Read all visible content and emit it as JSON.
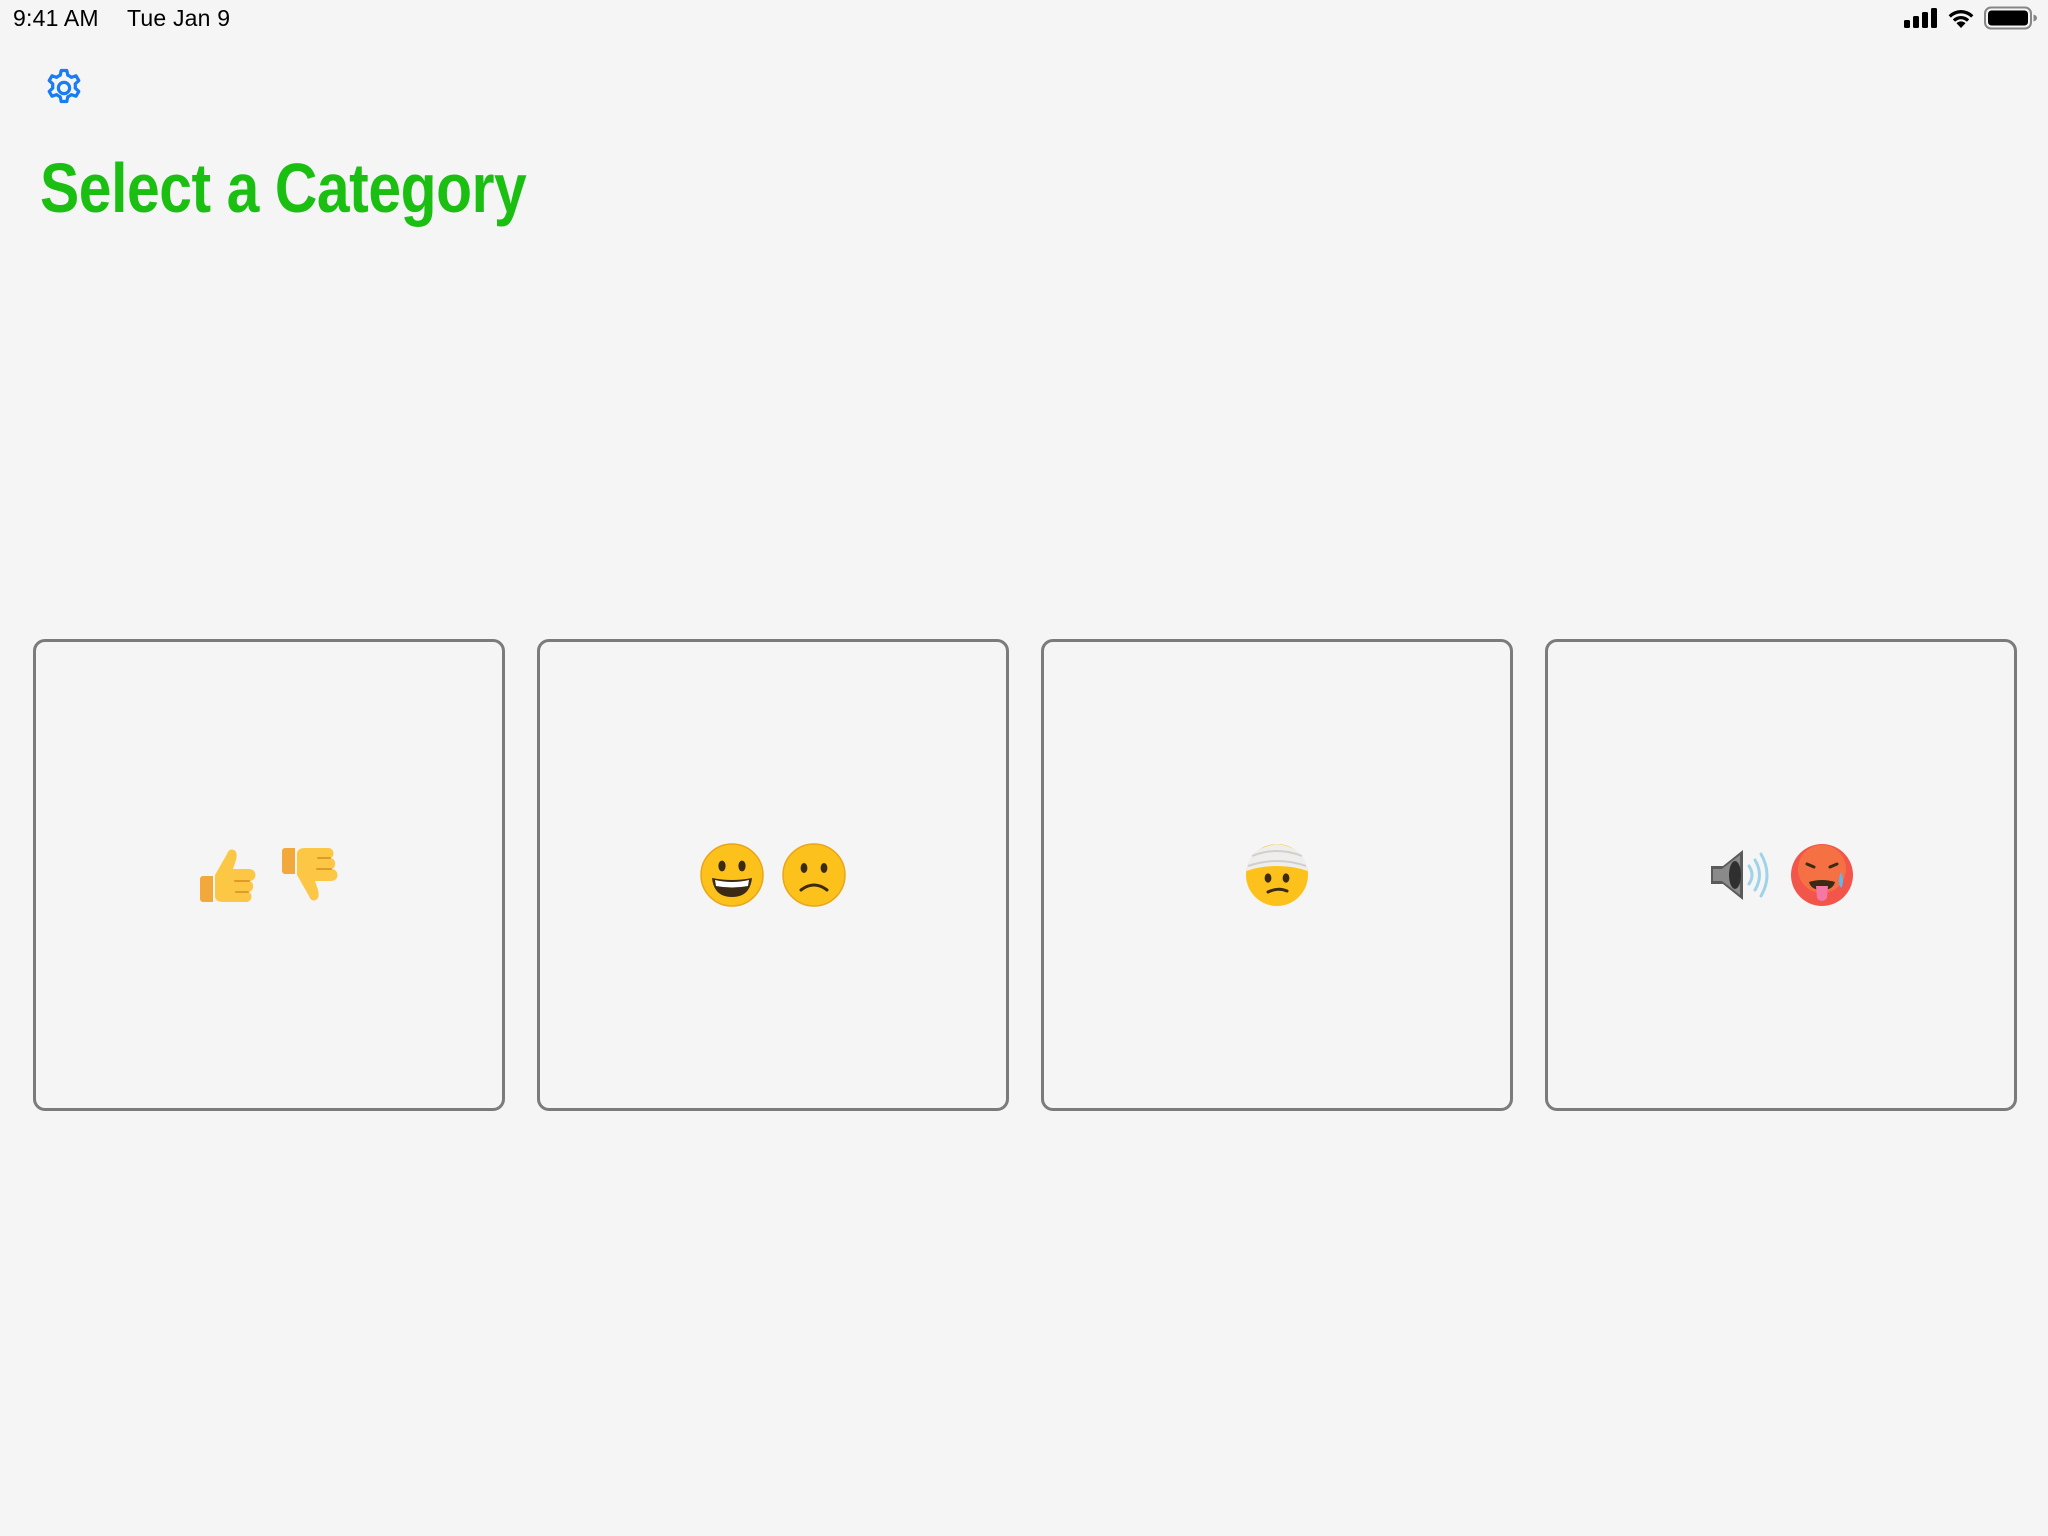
{
  "status_bar": {
    "time": "9:41 AM",
    "date": "Tue Jan 9",
    "icons": [
      "cellular-signal-icon",
      "wifi-icon",
      "battery-icon"
    ]
  },
  "toolbar": {
    "settings_icon": "gear-icon"
  },
  "header": {
    "title": "Select a Category"
  },
  "categories": [
    {
      "id": "thumbs",
      "icons": [
        "thumbs-up-icon",
        "thumbs-down-icon"
      ]
    },
    {
      "id": "faces",
      "icons": [
        "grinning-face-icon",
        "frowning-face-icon"
      ]
    },
    {
      "id": "injury",
      "icons": [
        "head-bandage-face-icon"
      ]
    },
    {
      "id": "senses",
      "icons": [
        "speaker-loud-icon",
        "hot-face-icon"
      ]
    }
  ],
  "colors": {
    "background": "#f5f5f5",
    "title": "#1abf12",
    "accent": "#1a7cf2",
    "card_border": "#7b7b7b"
  }
}
